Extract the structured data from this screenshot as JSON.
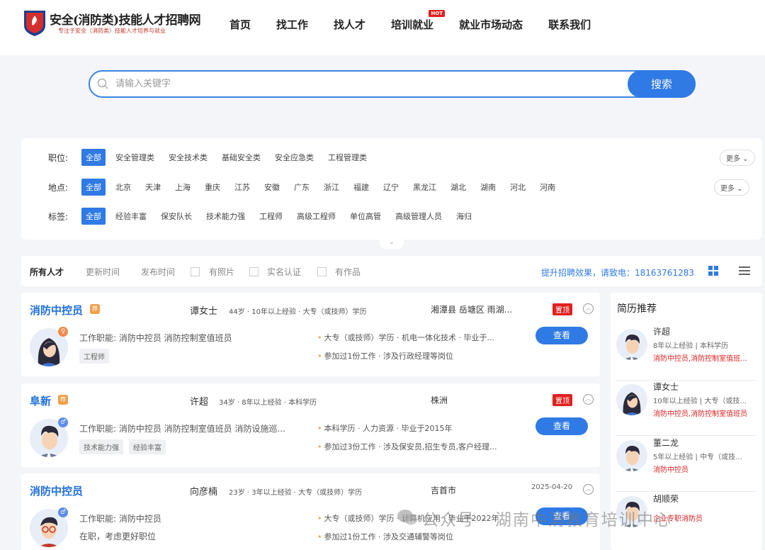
{
  "header": {
    "logo_title": "安全(消防类)技能人才招聘网",
    "logo_subtitle": "专注于安全（消防类）技能人才培养与就业",
    "nav": [
      {
        "label": "首页"
      },
      {
        "label": "找工作"
      },
      {
        "label": "找人才"
      },
      {
        "label": "培训就业",
        "badge": "HOT"
      },
      {
        "label": "就业市场动态"
      },
      {
        "label": "联系我们"
      }
    ]
  },
  "search": {
    "placeholder": "请输入关键字",
    "button": "搜索"
  },
  "filters": {
    "position": {
      "label": "职位:",
      "options": [
        "全部",
        "安全管理类",
        "安全技术类",
        "基础安全类",
        "安全应急类",
        "工程管理类"
      ],
      "more": "更多"
    },
    "location": {
      "label": "地点:",
      "options": [
        "全部",
        "北京",
        "天津",
        "上海",
        "重庆",
        "江苏",
        "安徽",
        "广东",
        "浙江",
        "福建",
        "辽宁",
        "黑龙江",
        "湖北",
        "湖南",
        "河北",
        "河南"
      ],
      "more": "更多"
    },
    "tags": {
      "label": "标签:",
      "options": [
        "全部",
        "经验丰富",
        "保安队长",
        "技术能力强",
        "工程师",
        "高级工程师",
        "单位高管",
        "高级管理人员",
        "海归"
      ]
    }
  },
  "sortbar": {
    "all": "所有人才",
    "update_time": "更新时间",
    "publish_time": "发布时间",
    "has_photo": "有照片",
    "verified": "实名认证",
    "has_works": "有作品",
    "promo": "提升招聘效果，请致电：18163761283"
  },
  "cards": [
    {
      "title": "消防中控员",
      "badge": "荐",
      "name": "谭女士",
      "meta": "44岁 · 10年以上经验 · 大专（或技师）学历",
      "location": "湘潭县 岳塘区 雨湖...",
      "top": "置顶",
      "date": "",
      "gender": "♀",
      "gender_color": "#f08a4b",
      "duty": "工作职能:  消防中控员 消防控制室值班员",
      "tags": [
        "工程师"
      ],
      "line1": "大专（或技师）学历 · 机电一体化技术 · 毕业于...",
      "line2": "参加过1份工作 · 涉及行政经理等岗位",
      "view": "查看",
      "avatar": "female"
    },
    {
      "title": "阜新",
      "badge": "荐",
      "name": "许超",
      "meta": "34岁 · 8年以上经验 · 本科学历",
      "location": "株洲",
      "top": "置顶",
      "date": "",
      "gender": "♂",
      "gender_color": "#5b8def",
      "duty": "工作职能:  消防中控员 消防控制室值班员 消防设施巡...",
      "tags": [
        "技术能力强",
        "经验丰富"
      ],
      "line1": "本科学历 · 人力资源 · 毕业于2015年",
      "line2": "参加过3份工作 · 涉及保安员,招生专员,客户经理...",
      "view": "查看",
      "avatar": "male"
    },
    {
      "title": "消防中控员",
      "badge": "",
      "name": "向彦楠",
      "meta": "23岁 · 3年以上经验 · 大专（或技师）学历",
      "location": "吉首市",
      "top": "",
      "date": "2025-04-20",
      "gender": "♂",
      "gender_color": "#5b8def",
      "duty": "工作职能:  消防中控员",
      "status": "在职，考虑更好职位",
      "tags": [],
      "line1": "大专（或技师）学历 · 计算机应用 · 毕业于2022年",
      "line2": "参加过1份工作 · 涉及交通辅警等岗位",
      "view": "查看",
      "avatar": "male-glasses"
    }
  ],
  "sidebar": {
    "title": "简历推荐",
    "items": [
      {
        "name": "许超",
        "info": "8年以上经验 | 本科学历",
        "duty": "消防中控员,消防控制室值班..."
      },
      {
        "name": "谭女士",
        "info": "10年以上经验 | 大专（或技...",
        "duty": "消防中控员,消防控制室值班员"
      },
      {
        "name": "董二龙",
        "info": "5年以上经验 | 中专（或技...",
        "duty": "消防中控员"
      },
      {
        "name": "胡顺荣",
        "info": "",
        "duty": "企业专职消防员"
      }
    ]
  },
  "watermark": "公众号 · 湖南中消教育培训中心",
  "colors": {
    "primary": "#2f7ae5",
    "top_badge": "#e02020",
    "orange": "#f0a04b"
  }
}
